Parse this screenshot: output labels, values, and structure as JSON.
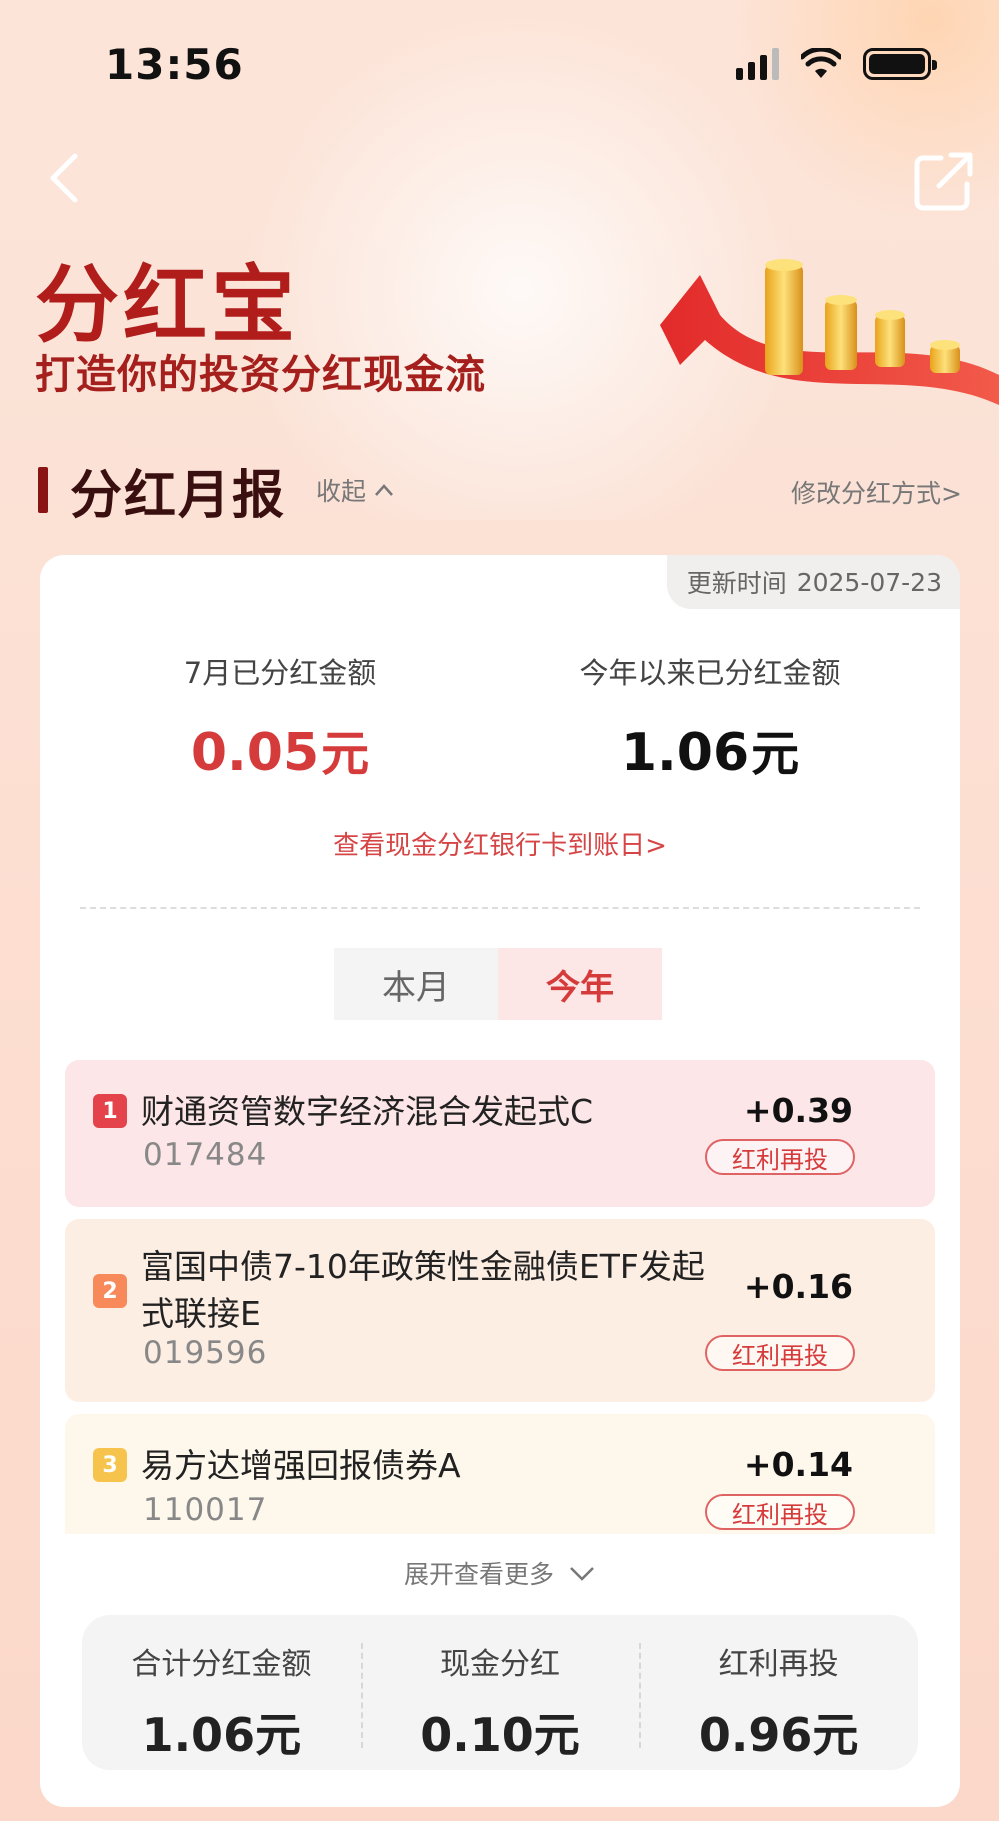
{
  "status_bar": {
    "time": "13:56"
  },
  "hero": {
    "title": "分红宝",
    "subtitle": "打造你的投资分红现金流"
  },
  "section": {
    "title": "分红月报",
    "collapse_label": "收起",
    "modify_label": "修改分红方式>"
  },
  "card": {
    "update_label": "更新时间",
    "update_date": "2025-07-23",
    "month": {
      "label": "7月已分红金额",
      "value": "0.05",
      "unit": "元"
    },
    "year": {
      "label": "今年以来已分红金额",
      "value": "1.06",
      "unit": "元"
    },
    "bank_link": "查看现金分红银行卡到账日>",
    "tabs": [
      {
        "label": "本月",
        "active": false
      },
      {
        "label": "今年",
        "active": true
      }
    ],
    "funds": [
      {
        "rank": "1",
        "name": "财通资管数字经济混合发起式C",
        "code": "017484",
        "amount": "+0.39",
        "tag": "红利再投"
      },
      {
        "rank": "2",
        "name": "富国中债7-10年政策性金融债ETF发起式联接E",
        "code": "019596",
        "amount": "+0.16",
        "tag": "红利再投"
      },
      {
        "rank": "3",
        "name": "易方达增强回报债券A",
        "code": "110017",
        "amount": "+0.14",
        "tag": "红利再投"
      }
    ],
    "expand_label": "展开查看更多",
    "totals": [
      {
        "label": "合计分红金额",
        "value": "1.06元"
      },
      {
        "label": "现金分红",
        "value": "0.10元"
      },
      {
        "label": "红利再投",
        "value": "0.96元"
      }
    ]
  },
  "colors": {
    "brand_red": "#d63b3b",
    "title_red": "#b01d1b",
    "dark_maroon": "#3a0f0f"
  },
  "icons": {
    "back": "chevron-left-icon",
    "share": "share-icon",
    "collapse": "chevron-up-icon",
    "expand": "chevron-down-icon"
  }
}
